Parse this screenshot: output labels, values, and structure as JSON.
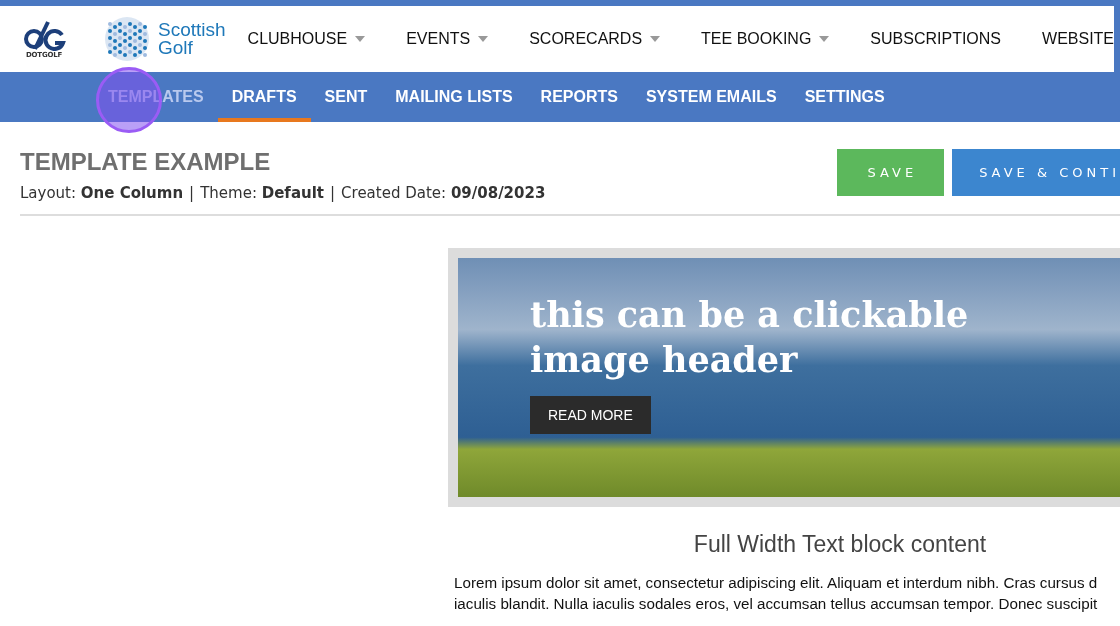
{
  "header": {
    "brand_small": "DOTGOLF",
    "partner": [
      "Scottish",
      "Golf"
    ],
    "nav": [
      {
        "label": "CLUBHOUSE",
        "dropdown": true
      },
      {
        "label": "EVENTS",
        "dropdown": true
      },
      {
        "label": "SCORECARDS",
        "dropdown": true
      },
      {
        "label": "TEE BOOKING",
        "dropdown": true
      },
      {
        "label": "SUBSCRIPTIONS",
        "dropdown": false
      },
      {
        "label": "WEBSITE",
        "dropdown": false
      }
    ]
  },
  "subnav": [
    {
      "label": "TEMPLATES",
      "selected": false,
      "marked": true
    },
    {
      "label": "DRAFTS",
      "selected": true,
      "marked": false
    },
    {
      "label": "SENT",
      "selected": false,
      "marked": false
    },
    {
      "label": "MAILING LISTS",
      "selected": false,
      "marked": false
    },
    {
      "label": "REPORTS",
      "selected": false,
      "marked": false
    },
    {
      "label": "SYSTEM EMAILS",
      "selected": false,
      "marked": false
    },
    {
      "label": "SETTINGS",
      "selected": false,
      "marked": false
    }
  ],
  "page": {
    "title": "TEMPLATE EXAMPLE",
    "separator": "|",
    "meta": [
      {
        "label": "Layout:",
        "value": "One Column"
      },
      {
        "label": "Theme:",
        "value": "Default"
      },
      {
        "label": "Created Date:",
        "value": "09/08/2023"
      }
    ],
    "buttons": [
      {
        "label": "SAVE",
        "kind": "success"
      },
      {
        "label": "SAVE & CONTI",
        "kind": "primary"
      }
    ]
  },
  "preview": {
    "header_text": [
      "this can be a clickable",
      "image header"
    ],
    "header_button": "READ MORE",
    "heading": "Full Width Text block content",
    "body_lines": [
      "Lorem ipsum dolor sit amet, consectetur adipiscing elit. Aliquam et interdum nibh. Cras cursus d",
      "iaculis blandit. Nulla iaculis sodales eros, vel accumsan tellus accumsan tempor. Donec suscipit"
    ]
  }
}
